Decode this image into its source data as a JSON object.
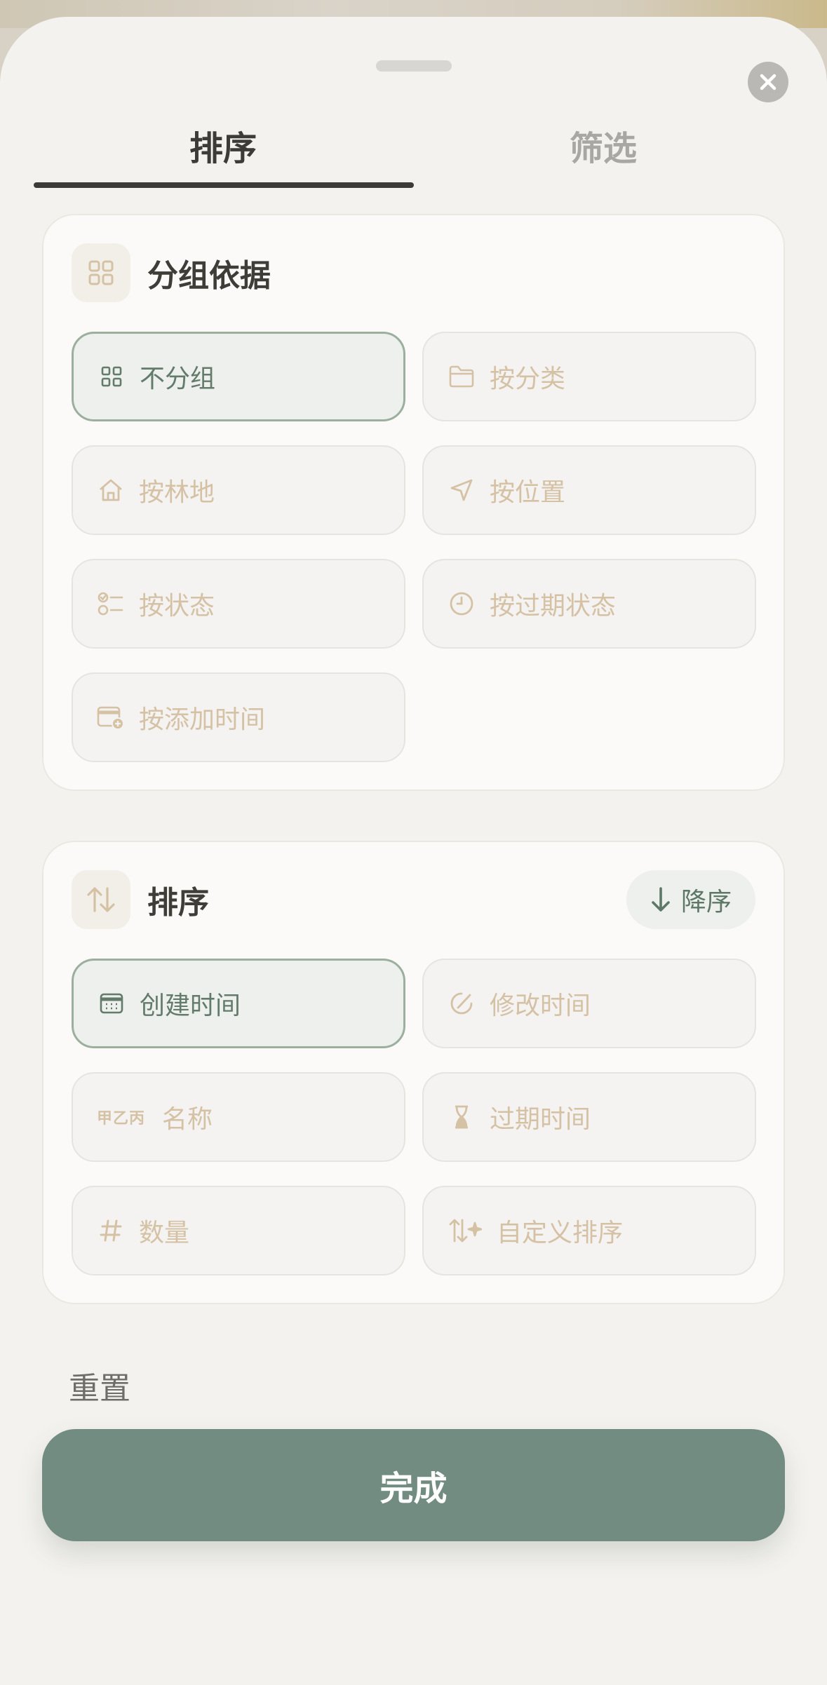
{
  "tabs": {
    "sort": "排序",
    "filter": "筛选",
    "active": "sort"
  },
  "group_section": {
    "title": "分组依据",
    "icon": "grid-icon",
    "options": [
      {
        "label": "不分组",
        "icon": "grid-icon",
        "selected": true
      },
      {
        "label": "按分类",
        "icon": "folder-icon",
        "selected": false
      },
      {
        "label": "按林地",
        "icon": "home-icon",
        "selected": false
      },
      {
        "label": "按位置",
        "icon": "location-arrow-icon",
        "selected": false
      },
      {
        "label": "按状态",
        "icon": "checklist-icon",
        "selected": false
      },
      {
        "label": "按过期状态",
        "icon": "clock-icon",
        "selected": false
      },
      {
        "label": "按添加时间",
        "icon": "calendar-add-icon",
        "selected": false
      }
    ]
  },
  "sort_section": {
    "title": "排序",
    "icon": "sort-arrows-icon",
    "order_label": "降序",
    "options": [
      {
        "label": "创建时间",
        "icon": "calendar-icon",
        "selected": true
      },
      {
        "label": "修改时间",
        "icon": "edit-clock-icon",
        "selected": false
      },
      {
        "label": "名称",
        "icon": "text-sort-icon",
        "icon_text": "甲乙丙",
        "selected": false
      },
      {
        "label": "过期时间",
        "icon": "hourglass-icon",
        "selected": false
      },
      {
        "label": "数量",
        "icon": "hash-icon",
        "selected": false
      },
      {
        "label": "自定义排序",
        "icon": "custom-sort-icon",
        "selected": false
      }
    ]
  },
  "reset_label": "重置",
  "done_label": "完成",
  "colors": {
    "accent": "#728c82",
    "selected_bg": "#edf0ec",
    "selected_border": "#9caf9f",
    "inactive_text": "#d5c2a5"
  }
}
